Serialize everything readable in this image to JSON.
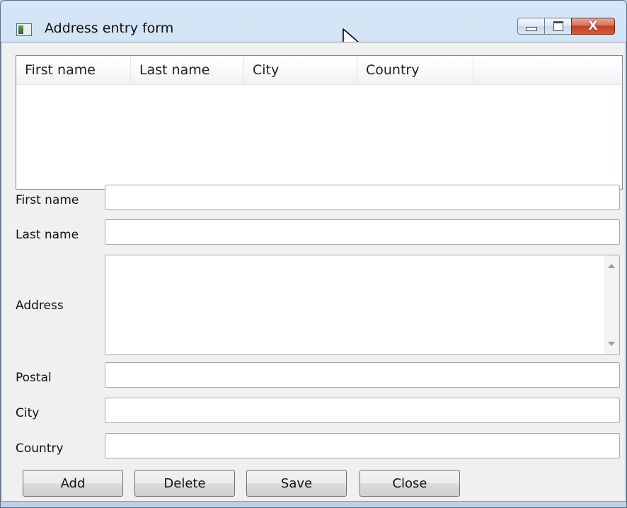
{
  "window": {
    "title": "Address entry form"
  },
  "list": {
    "columns": [
      "First name",
      "Last name",
      "City",
      "Country",
      ""
    ]
  },
  "form": {
    "first_name_label": "First name",
    "last_name_label": "Last name",
    "address_label": "Address",
    "postal_label": "Postal",
    "city_label": "City",
    "country_label": "Country",
    "first_name_value": "",
    "last_name_value": "",
    "address_value": "",
    "postal_value": "",
    "city_value": "",
    "country_value": ""
  },
  "buttons": {
    "add": "Add",
    "delete": "Delete",
    "save": "Save",
    "close": "Close"
  },
  "caption": {
    "close_glyph": "X"
  }
}
